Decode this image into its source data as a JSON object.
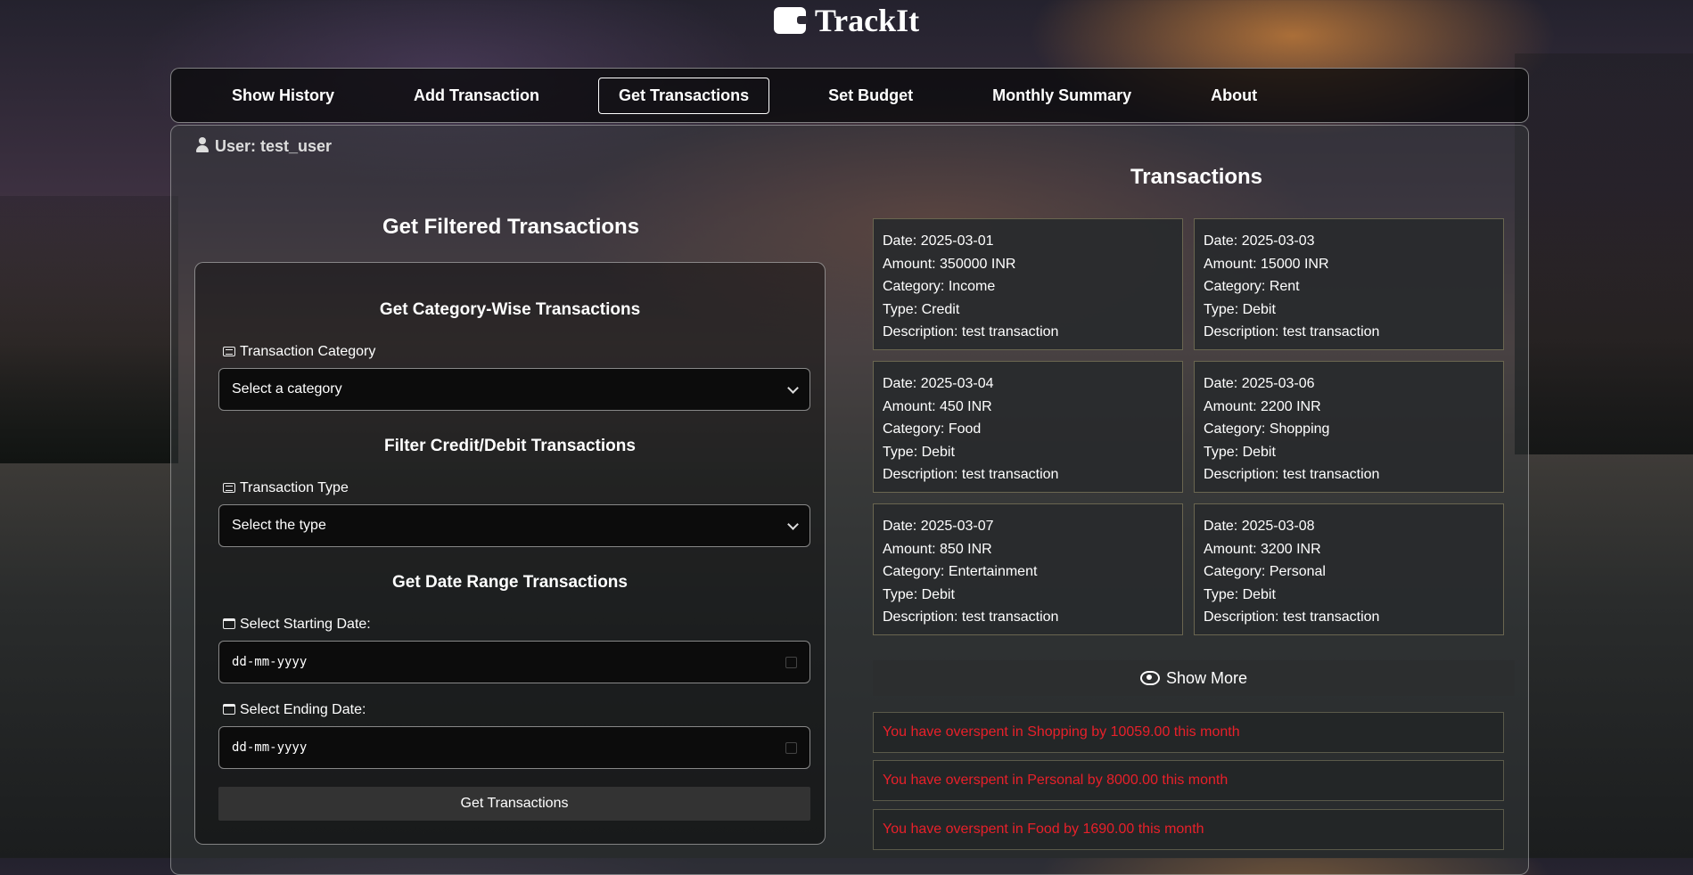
{
  "app": {
    "title": "TrackIt",
    "logo_icon": "wallet-icon"
  },
  "nav": {
    "items": [
      {
        "label": "Show History",
        "active": false
      },
      {
        "label": "Add Transaction",
        "active": false
      },
      {
        "label": "Get Transactions",
        "active": true
      },
      {
        "label": "Set Budget",
        "active": false
      },
      {
        "label": "Monthly Summary",
        "active": false
      },
      {
        "label": "About",
        "active": false
      }
    ]
  },
  "user": {
    "label": "User: test_user",
    "icon": "user-icon"
  },
  "filter": {
    "title": "Get Filtered Transactions",
    "category_section": "Get Category-Wise Transactions",
    "category_label": "Transaction Category",
    "category_select": "Select a category",
    "type_section": "Filter Credit/Debit Transactions",
    "type_label": "Transaction Type",
    "type_select": "Select the type",
    "date_section": "Get Date Range Transactions",
    "start_label": "Select Starting Date:",
    "start_placeholder": "dd-mm-yyyy",
    "end_label": "Select Ending Date:",
    "end_placeholder": "dd-mm-yyyy",
    "submit_label": "Get Transactions"
  },
  "transactions": {
    "title": "Transactions",
    "items": [
      {
        "date": "Date: 2025-03-01",
        "amount": "Amount: 350000 INR",
        "category": "Category: Income",
        "type": "Type: Credit",
        "description": "Description: test transaction"
      },
      {
        "date": "Date: 2025-03-03",
        "amount": "Amount: 15000 INR",
        "category": "Category: Rent",
        "type": "Type: Debit",
        "description": "Description: test transaction"
      },
      {
        "date": "Date: 2025-03-04",
        "amount": "Amount: 450 INR",
        "category": "Category: Food",
        "type": "Type: Debit",
        "description": "Description: test transaction"
      },
      {
        "date": "Date: 2025-03-06",
        "amount": "Amount: 2200 INR",
        "category": "Category: Shopping",
        "type": "Type: Debit",
        "description": "Description: test transaction"
      },
      {
        "date": "Date: 2025-03-07",
        "amount": "Amount: 850 INR",
        "category": "Category: Entertainment",
        "type": "Type: Debit",
        "description": "Description: test transaction"
      },
      {
        "date": "Date: 2025-03-08",
        "amount": "Amount: 3200 INR",
        "category": "Category: Personal",
        "type": "Type: Debit",
        "description": "Description: test transaction"
      }
    ],
    "show_more_label": "Show More"
  },
  "alerts": [
    "You have overspent in Shopping by 10059.00 this month",
    "You have overspent in Personal by 8000.00 this month",
    "You have overspent in Food by 1690.00 this month"
  ],
  "colors": {
    "alert_text": "#e8202a",
    "card_border": "#6a6650"
  }
}
